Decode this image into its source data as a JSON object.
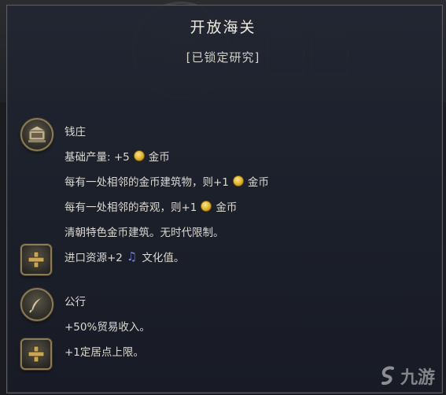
{
  "tooltip": {
    "title": "开放海关",
    "status": "[已锁定研究]"
  },
  "sections": [
    {
      "icon": "bank-building-icon",
      "lines": [
        {
          "text": "钱庄"
        },
        {
          "text": "基础产量: +5",
          "after_icon": "gold-coin-icon",
          "suffix": "金币"
        },
        {
          "text": "每有一处相邻的金币建筑物，则+1",
          "after_icon": "gold-coin-icon",
          "suffix": "金币"
        },
        {
          "text": "每有一处相邻的奇观，则+1",
          "after_icon": "gold-coin-icon",
          "suffix": "金币"
        },
        {
          "text": "清朝特色金币建筑。无时代限制。"
        }
      ]
    },
    {
      "icon": "plus-icon",
      "lines": [
        {
          "text": "进口资源+2",
          "after_icon": "music-note-icon",
          "suffix": "文化值。"
        }
      ]
    },
    {
      "icon": "quill-icon",
      "lines": [
        {
          "text": "公行"
        },
        {
          "text": "+50%贸易收入。"
        }
      ]
    },
    {
      "icon": "plus-icon",
      "lines": [
        {
          "text": "+1定居点上限。"
        }
      ]
    }
  ],
  "watermark": {
    "text": "九游"
  },
  "colors": {
    "gold": "#e0b32c",
    "culture": "#6f84e0",
    "frame": "#8a7b55"
  }
}
